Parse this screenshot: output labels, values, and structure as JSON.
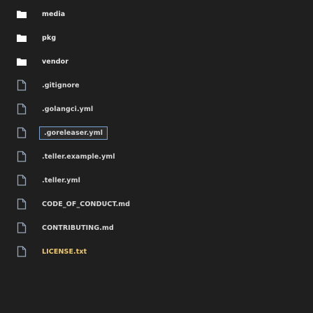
{
  "tree": {
    "items": [
      {
        "label": "media",
        "kind": "folder"
      },
      {
        "label": "pkg",
        "kind": "folder"
      },
      {
        "label": "vendor",
        "kind": "folder"
      },
      {
        "label": ".gitignore",
        "kind": "file"
      },
      {
        "label": ".golangci.yml",
        "kind": "file"
      },
      {
        "label": ".goreleaser.yml",
        "kind": "file",
        "selected": true
      },
      {
        "label": ".teller.example.yml",
        "kind": "file"
      },
      {
        "label": ".teller.yml",
        "kind": "file"
      },
      {
        "label": "CODE_OF_CONDUCT.md",
        "kind": "file"
      },
      {
        "label": "CONTRIBUTING.md",
        "kind": "file"
      },
      {
        "label": "LICENSE.txt",
        "kind": "file",
        "highlight": true
      }
    ]
  },
  "colors": {
    "background": "#1f1f1f",
    "folder_icon": "#ffffff",
    "file_icon": "#9aa7b8",
    "text": "#e6e6e6",
    "selection_border": "#7aa3d6",
    "highlight_text": "#f0c96a"
  },
  "icons": {
    "folder": "folder-icon",
    "file": "file-icon"
  }
}
